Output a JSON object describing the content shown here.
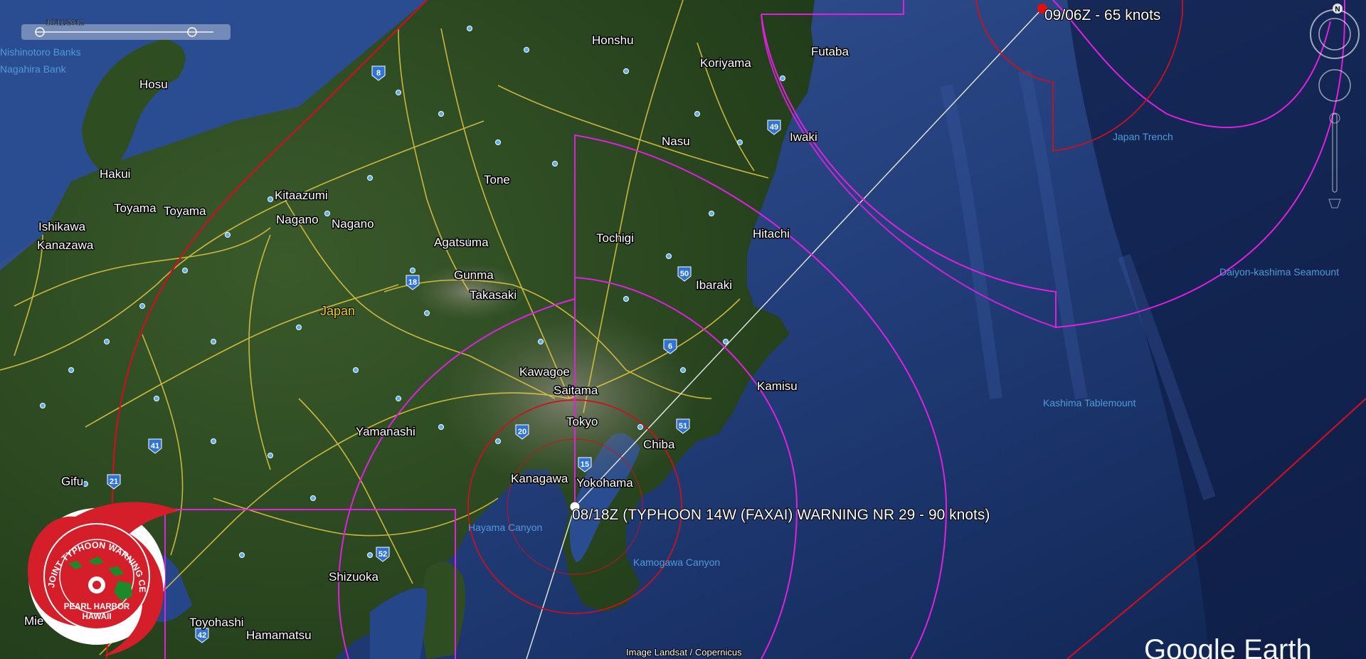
{
  "date_label": "10/11/2012",
  "map": {
    "places": [
      {
        "id": "honshu",
        "text": "Honshu",
        "style": "small"
      },
      {
        "id": "koriyama",
        "text": "Koriyama"
      },
      {
        "id": "futaba",
        "text": "Futaba"
      },
      {
        "id": "iwaki",
        "text": "Iwaki"
      },
      {
        "id": "nasu",
        "text": "Nasu"
      },
      {
        "id": "tone",
        "text": "Tone"
      },
      {
        "id": "tochigi",
        "text": "Tochigi"
      },
      {
        "id": "hitachi",
        "text": "Hitachi"
      },
      {
        "id": "ibaraki",
        "text": "Ibaraki"
      },
      {
        "id": "kamisu",
        "text": "Kamisu"
      },
      {
        "id": "agatsuma",
        "text": "Agatsuma"
      },
      {
        "id": "gunma",
        "text": "Gunma"
      },
      {
        "id": "takasaki",
        "text": "Takasaki"
      },
      {
        "id": "kitaazumi",
        "text": "Kitaazumi"
      },
      {
        "id": "nagano1",
        "text": "Nagano"
      },
      {
        "id": "nagano2",
        "text": "Nagano"
      },
      {
        "id": "hosu",
        "text": "Hosu"
      },
      {
        "id": "hakui",
        "text": "Hakui"
      },
      {
        "id": "toyama1",
        "text": "Toyama"
      },
      {
        "id": "toyama2",
        "text": "Toyama"
      },
      {
        "id": "ishikawa",
        "text": "Ishikawa"
      },
      {
        "id": "kanazawa",
        "text": "Kanazawa"
      },
      {
        "id": "kawagoe",
        "text": "Kawagoe"
      },
      {
        "id": "saitama",
        "text": "Saitama"
      },
      {
        "id": "tokyo",
        "text": "Tokyo"
      },
      {
        "id": "chiba",
        "text": "Chiba"
      },
      {
        "id": "kanagawa",
        "text": "Kanagawa"
      },
      {
        "id": "yokohama",
        "text": "Yokohama"
      },
      {
        "id": "yamanashi",
        "text": "Yamanashi"
      },
      {
        "id": "shizuoka",
        "text": "Shizuoka"
      },
      {
        "id": "toyohashi",
        "text": "Toyohashi"
      },
      {
        "id": "hamamatsu",
        "text": "Hamamatsu"
      },
      {
        "id": "gifu",
        "text": "Gifu"
      },
      {
        "id": "mie",
        "text": "Mie"
      },
      {
        "id": "japan",
        "text": "Japan"
      }
    ],
    "sea_labels": [
      {
        "id": "nishinotoro",
        "text": "Nishinotoro Banks"
      },
      {
        "id": "nagahira",
        "text": "Nagahira Bank"
      },
      {
        "id": "japan-trench",
        "text": "Japan Trench"
      },
      {
        "id": "daiyon",
        "text": "Daiyon-kashima Seamount"
      },
      {
        "id": "kashima",
        "text": "Kashima Tablemount"
      },
      {
        "id": "hayama",
        "text": "Hayama Canyon"
      },
      {
        "id": "kamogawa",
        "text": "Kamogawa Canyon"
      }
    ],
    "highway_shields": [
      "8",
      "49",
      "18",
      "50",
      "6",
      "51",
      "20",
      "15",
      "41",
      "21",
      "52",
      "42"
    ]
  },
  "warning": {
    "current": "08/18Z (TYPHOON 14W (FAXAI) WARNING NR 29    - 90 knots)",
    "forecast": "09/06Z - 65 knots"
  },
  "logo": {
    "top_text": "JOINT TYPHOON WARNING CENTER",
    "line1": "PEARL HARBOR",
    "line2": "HAWAII"
  },
  "credit": "Image Landsat / Copernicus",
  "brand": "Google Earth",
  "colors": {
    "wind_radii": "#e020e0",
    "danger_area": "#cc1020",
    "land": "#2b4a1e",
    "ocean": "#22407e",
    "roads": "#e8c840",
    "track": "#e8e8e8"
  },
  "controls": [
    "compass-north",
    "look-joystick",
    "move-joystick",
    "zoom-slider"
  ],
  "compass_letter": "N"
}
